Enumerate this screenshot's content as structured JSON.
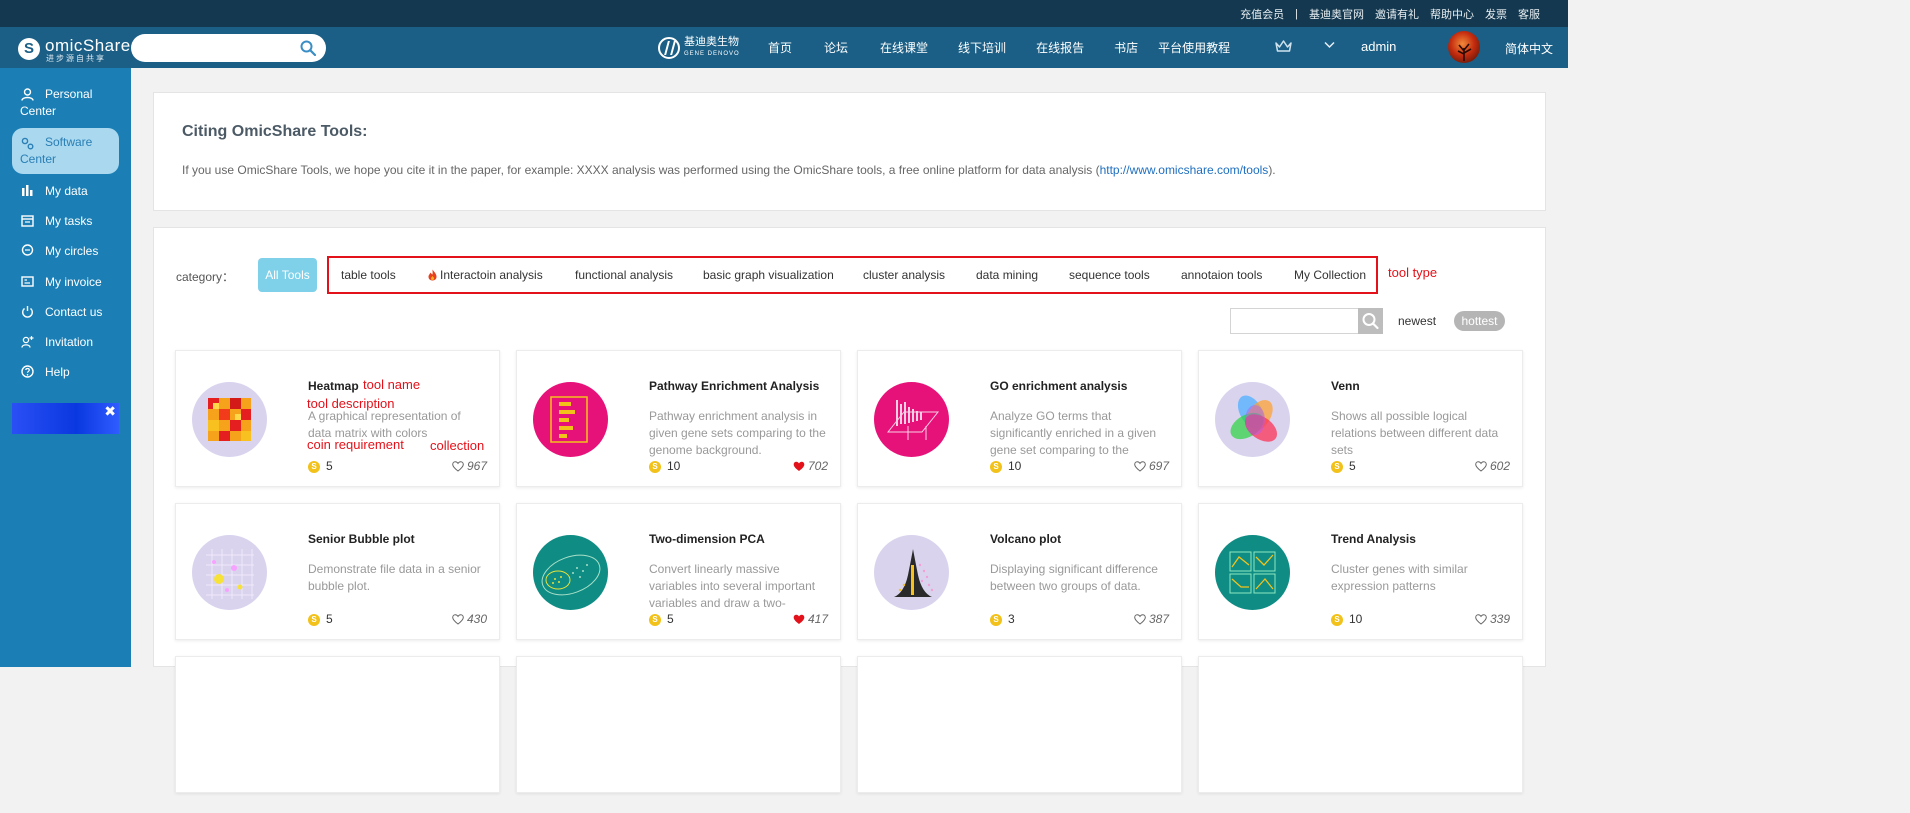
{
  "topbar": {
    "links": [
      "充值会员",
      "|",
      "基迪奥官网",
      "邀请有礼",
      "帮助中心",
      "发票",
      "客服"
    ]
  },
  "header": {
    "logo_name": "omicShare",
    "logo_letter": "S",
    "logo_sub": "进步源自共享",
    "brand_cn": "基迪奥生物",
    "brand_en": "GENE DENOVO",
    "nav": [
      "首页",
      "论坛",
      "在线课堂",
      "线下培训",
      "在线报告",
      "书店",
      "平台使用教程"
    ],
    "user": "admin",
    "language": "简体中文",
    "search_placeholder": ""
  },
  "sidebar": {
    "items": [
      {
        "label": "Personal Center",
        "icon": "person-icon"
      },
      {
        "label": "Software Center",
        "icon": "gears-icon",
        "active": true
      },
      {
        "label": "My data",
        "icon": "bar-chart-icon"
      },
      {
        "label": "My tasks",
        "icon": "calendar-icon"
      },
      {
        "label": "My circles",
        "icon": "chat-icon"
      },
      {
        "label": "My invoice",
        "icon": "invoice-icon"
      },
      {
        "label": "Contact us",
        "icon": "power-icon"
      },
      {
        "label": "Invitation",
        "icon": "add-user-icon"
      },
      {
        "label": "Help",
        "icon": "question-icon"
      }
    ],
    "banner_close": "✖"
  },
  "cite": {
    "title": "Citing OmicShare Tools:",
    "text": "If you use OmicShare Tools, we hope you cite it in the paper, for example: XXXX analysis was performed using the OmicShare tools, a free online platform for data analysis (",
    "link": "http://www.omicshare.com/tools",
    "text_end": ")."
  },
  "tools": {
    "category_label": "category：",
    "all_tools": "All Tools",
    "types": [
      "table tools",
      "Interactoin analysis",
      "functional analysis",
      "basic graph visualization",
      "cluster analysis",
      "data mining",
      "sequence tools",
      "annotaion tools",
      "My Collection"
    ],
    "annotations": {
      "tool_type": "tool type",
      "tool_name": "tool name",
      "tool_description": "tool description",
      "coin_requirement": "coin requirement",
      "collection": "collection"
    },
    "sort": {
      "newest": "newest",
      "hottest": "hottest"
    },
    "coin_symbol": "S",
    "cards": [
      {
        "name": "Heatmap",
        "desc": "A graphical representation of data matrix with colors",
        "coins": "5",
        "favs": "967",
        "liked": false
      },
      {
        "name": "Pathway Enrichment Analysis",
        "desc": "Pathway enrichment analysis in given gene sets comparing to the genome background.",
        "coins": "10",
        "favs": "702",
        "liked": true
      },
      {
        "name": "GO enrichment analysis",
        "desc": "Analyze GO terms that significantly enriched in a given gene set comparing to the genome background.",
        "coins": "10",
        "favs": "697",
        "liked": false
      },
      {
        "name": "Venn",
        "desc": "Shows all possible logical relations between different data sets",
        "coins": "5",
        "favs": "602",
        "liked": false
      },
      {
        "name": "Senior Bubble plot",
        "desc": "Demonstrate file data in a senior bubble plot.",
        "coins": "5",
        "favs": "430",
        "liked": false
      },
      {
        "name": "Two-dimension PCA",
        "desc": "Convert linearly massive variables into several important variables and draw a two-dimension score plot.",
        "coins": "5",
        "favs": "417",
        "liked": true
      },
      {
        "name": "Volcano plot",
        "desc": "Displaying significant difference between two groups of data.",
        "coins": "3",
        "favs": "387",
        "liked": false
      },
      {
        "name": "Trend Analysis",
        "desc": "Cluster genes with similar expression patterns",
        "coins": "10",
        "favs": "339",
        "liked": false
      }
    ]
  },
  "colors": {
    "topbar": "#14384f",
    "header": "#1b5f86",
    "sidebar": "#1b7fb5",
    "accent": "#7fd1ea",
    "annotation": "#e3121a",
    "coin": "#f2c21b",
    "liked": "#e3121a"
  }
}
